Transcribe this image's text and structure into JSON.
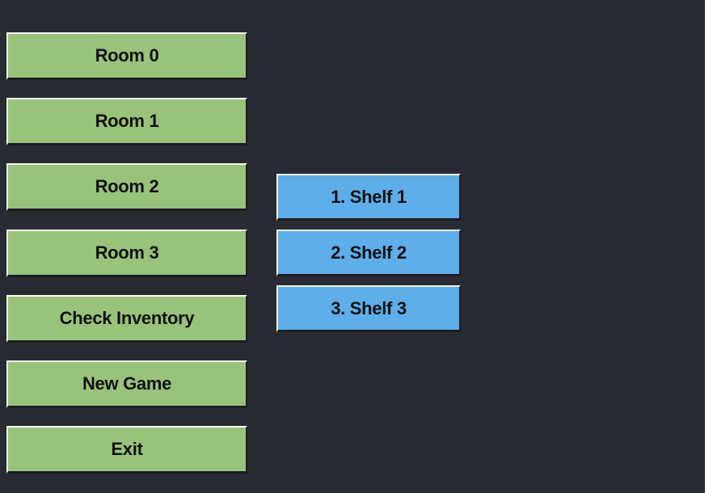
{
  "colors": {
    "background": "#292b33",
    "menu_button": "#99c27b",
    "shelf_button": "#5eaeea",
    "label": "#111111"
  },
  "menu": {
    "items": [
      {
        "label": "Room 0"
      },
      {
        "label": "Room 1"
      },
      {
        "label": "Room 2"
      },
      {
        "label": "Room 3"
      },
      {
        "label": "Check Inventory"
      },
      {
        "label": "New Game"
      },
      {
        "label": "Exit"
      }
    ]
  },
  "shelves": {
    "items": [
      {
        "label": "1. Shelf 1"
      },
      {
        "label": "2. Shelf 2"
      },
      {
        "label": "3. Shelf 3"
      }
    ]
  }
}
